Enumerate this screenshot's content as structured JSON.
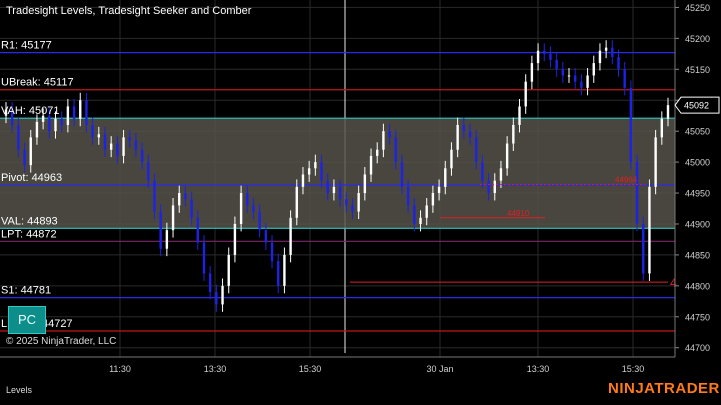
{
  "header": {
    "title": "Tradesight Levels, Tradesight Seeker and Comber",
    "copyright": "© 2025 NinjaTrader, LLC",
    "panel_label": "Levels",
    "brand": "NINJATRADER",
    "pc_button": "PC",
    "last_price": "45092"
  },
  "colors": {
    "background": "#000000",
    "value_area_fill": "#55524a",
    "blue_level": "#2a2ae8",
    "red_level": "#c01818",
    "teal_level": "#28c8c0",
    "purple_level": "#7a2a6a",
    "candle_up": "#ffffff",
    "candle_down": "#1e22e6",
    "signal_green": "#33a033",
    "signal_red": "#e02020"
  },
  "chart_data": {
    "type": "candlestick",
    "title": "Tradesight Levels, Tradesight Seeker and Comber",
    "ylim": [
      44685,
      45262
    ],
    "y_ticks": [
      44700,
      44750,
      44800,
      44850,
      44900,
      44950,
      45000,
      45050,
      45100,
      45150,
      45200,
      45250
    ],
    "x_ticks": [
      "11:30",
      "13:30",
      "15:30",
      "30 Jan",
      "13:30",
      "15:30"
    ],
    "grid": true,
    "levels": [
      {
        "label": "R1: 45177",
        "value": 45177,
        "color": "blue"
      },
      {
        "label": "UBreak: 45117",
        "value": 45117,
        "color": "red"
      },
      {
        "label": "VAH: 45071",
        "value": 45071,
        "color": "teal"
      },
      {
        "label": "Pivot: 44963",
        "value": 44963,
        "color": "blue"
      },
      {
        "label": "VAL: 44893",
        "value": 44893,
        "color": "teal"
      },
      {
        "label": "LPT: 44872",
        "value": 44872,
        "color": "purple"
      },
      {
        "label": "S1: 44781",
        "value": 44781,
        "color": "blue"
      },
      {
        "label": "LBreak: 44727",
        "value": 44727,
        "color": "red"
      }
    ],
    "value_area": [
      44893,
      45071
    ],
    "last_price": 45092,
    "signal_levels": [
      {
        "label": "44910",
        "value": 44910,
        "color": "red"
      },
      {
        "label": "44964",
        "value": 44964,
        "color": "red"
      },
      {
        "label": "4",
        "value": 44806,
        "color": "red"
      }
    ],
    "candles": [
      45085,
      45060,
      45020,
      44995,
      45040,
      45065,
      45075,
      45050,
      45070,
      45060,
      45090,
      45070,
      45100,
      45060,
      45040,
      45045,
      45020,
      45030,
      45010,
      45040,
      45035,
      45020,
      45000,
      44970,
      44920,
      44860,
      44890,
      44930,
      44950,
      44940,
      44910,
      44870,
      44820,
      44790,
      44770,
      44800,
      44850,
      44900,
      44950,
      44930,
      44920,
      44890,
      44870,
      44840,
      44800,
      44850,
      44910,
      44960,
      44980,
      44990,
      45000,
      44970,
      44950,
      44960,
      44940,
      44930,
      44920,
      44950,
      44980,
      45010,
      45020,
      45050,
      45040,
      45000,
      44960,
      44930,
      44900,
      44910,
      44930,
      44950,
      44960,
      44990,
      45020,
      45060,
      45050,
      45040,
      45000,
      44970,
      44950,
      44970,
      44990,
      45030,
      45060,
      45090,
      45130,
      45160,
      45180,
      45175,
      45165,
      45150,
      45140,
      45140,
      45130,
      45120,
      45140,
      45160,
      45180,
      45185,
      45170,
      45150,
      45120,
      45000,
      44900,
      44820,
      44960,
      45040,
      45070,
      45092
    ]
  }
}
